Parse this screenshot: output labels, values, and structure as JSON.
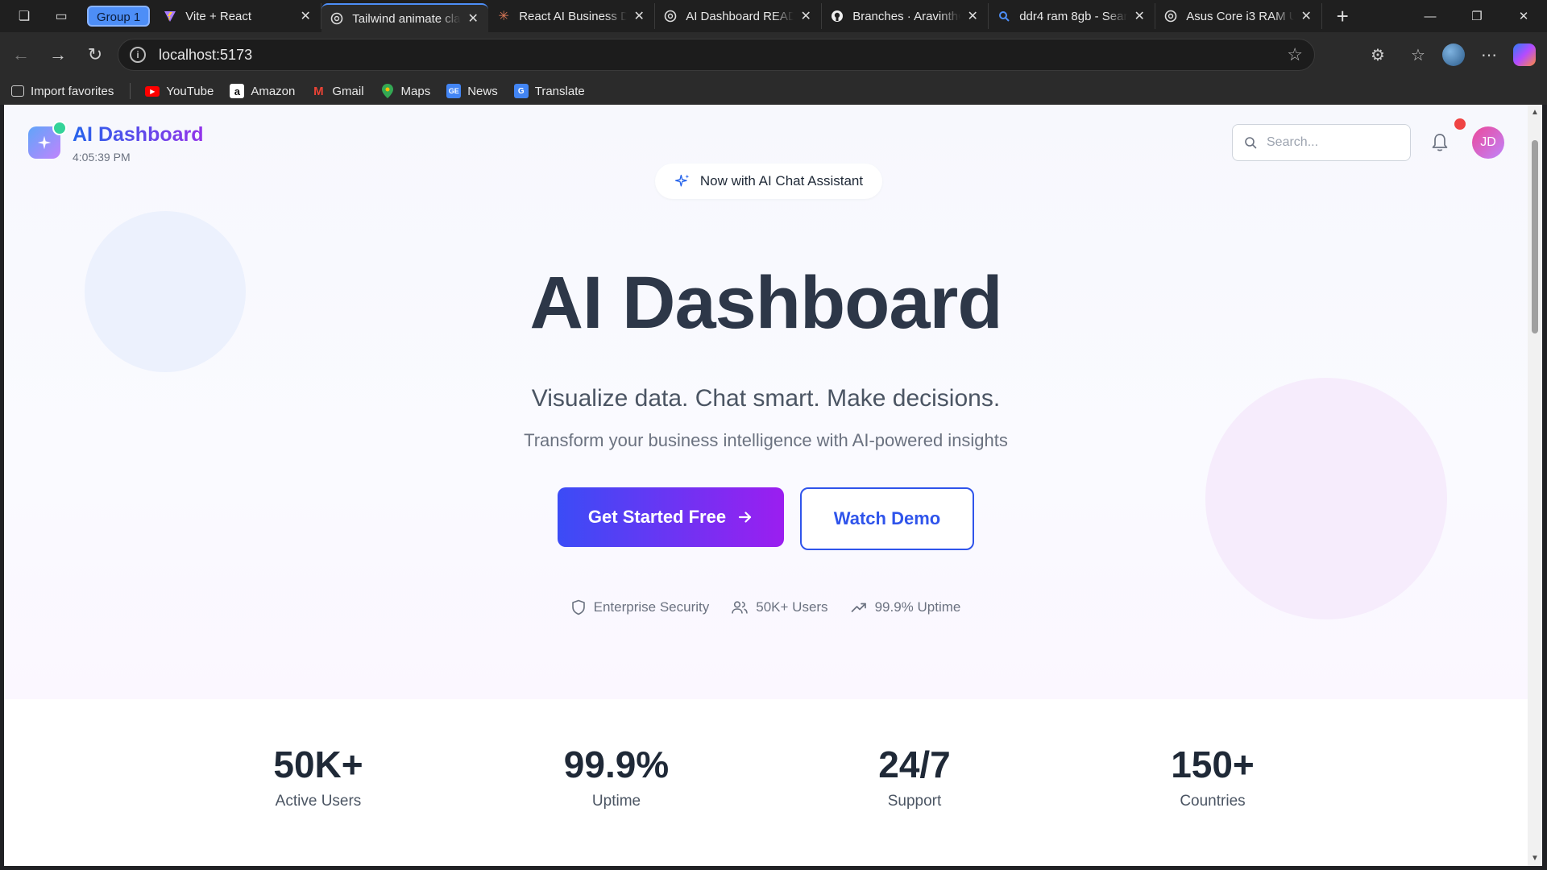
{
  "browser": {
    "group_label": "Group 1",
    "tabs": [
      {
        "title": "Vite + React",
        "icon": "vite-icon",
        "active": false
      },
      {
        "title": "Tailwind animate cla",
        "icon": "chatgpt-icon",
        "active": true
      },
      {
        "title": "React AI Business D",
        "icon": "claude-icon",
        "active": false
      },
      {
        "title": "AI Dashboard READ",
        "icon": "chatgpt-icon",
        "active": false
      },
      {
        "title": "Branches · AravinthO",
        "icon": "github-icon",
        "active": false
      },
      {
        "title": "ddr4 ram 8gb - Sear",
        "icon": "search-icon",
        "active": false
      },
      {
        "title": "Asus Core i3 RAM U",
        "icon": "chatgpt-icon",
        "active": false
      }
    ],
    "url": "localhost:5173",
    "bookmarks": [
      {
        "label": "Import favorites",
        "icon": "import-icon"
      },
      {
        "label": "YouTube",
        "icon": "youtube-icon",
        "color": "#ff0000"
      },
      {
        "label": "Amazon",
        "icon": "amazon-icon",
        "color": "#ffffff"
      },
      {
        "label": "Gmail",
        "icon": "gmail-icon",
        "color": "#ea4335"
      },
      {
        "label": "Maps",
        "icon": "maps-icon",
        "color": "#34a853"
      },
      {
        "label": "News",
        "icon": "news-icon",
        "color": "#4285f4"
      },
      {
        "label": "Translate",
        "icon": "translate-icon",
        "color": "#4285f4"
      }
    ]
  },
  "app": {
    "brand": "AI Dashboard",
    "clock": "4:05:39 PM",
    "search_placeholder": "Search...",
    "avatar_initials": "JD",
    "colors": {
      "primary": "#3b4cf6",
      "accent": "#9b1ef0",
      "notify": "#ef4444"
    }
  },
  "hero": {
    "chip": "Now with AI Chat Assistant",
    "title": "AI Dashboard",
    "tagline": "Visualize data. Chat smart. Make decisions.",
    "subtagline": "Transform your business intelligence with AI-powered insights",
    "cta_primary": "Get Started Free",
    "cta_secondary": "Watch Demo",
    "features": [
      {
        "label": "Enterprise Security",
        "icon": "shield-icon"
      },
      {
        "label": "50K+ Users",
        "icon": "users-icon"
      },
      {
        "label": "99.9% Uptime",
        "icon": "trending-up-icon"
      }
    ]
  },
  "stats": [
    {
      "value": "50K+",
      "label": "Active Users"
    },
    {
      "value": "99.9%",
      "label": "Uptime"
    },
    {
      "value": "24/7",
      "label": "Support"
    },
    {
      "value": "150+",
      "label": "Countries"
    }
  ]
}
